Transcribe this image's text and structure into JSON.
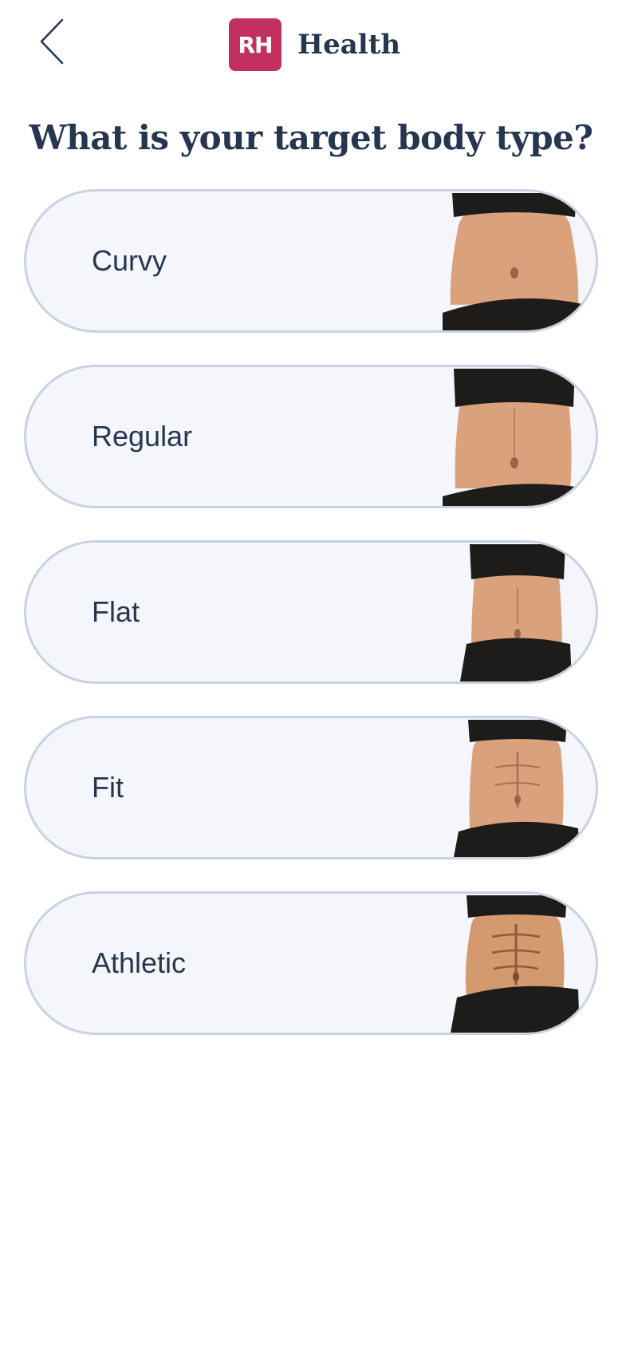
{
  "header": {
    "back_icon": "chevron-left-icon",
    "logo_text": "RH",
    "app_name": "Health"
  },
  "title": "What is your target body type?",
  "options": [
    {
      "label": "Curvy",
      "image": "curvy-torso-image"
    },
    {
      "label": "Regular",
      "image": "regular-torso-image"
    },
    {
      "label": "Flat",
      "image": "flat-torso-image"
    },
    {
      "label": "Fit",
      "image": "fit-torso-image"
    },
    {
      "label": "Athletic",
      "image": "athletic-torso-image"
    }
  ],
  "colors": {
    "brand": "#c2305f",
    "text": "#263650",
    "option_bg": "#f4f6fb",
    "option_border": "#c9d2e0",
    "skin": "#d9a27c",
    "garment": "#1e1c1a"
  }
}
